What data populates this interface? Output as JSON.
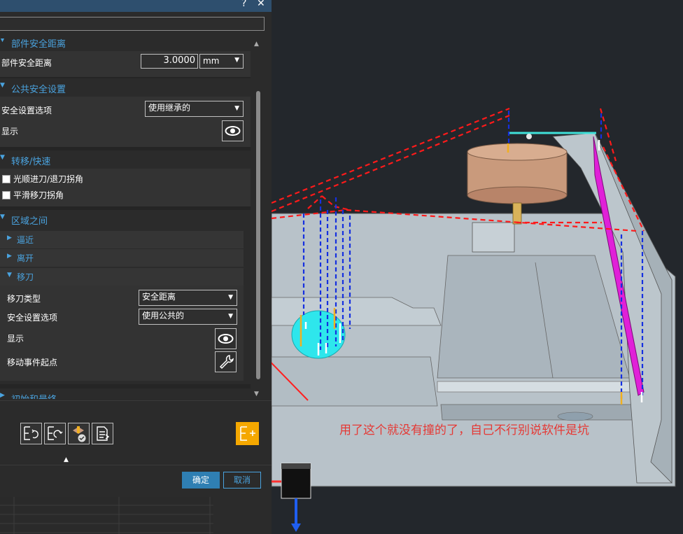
{
  "titlebar": {
    "help_icon": "?",
    "close_icon": "✕"
  },
  "part_clearance": {
    "header": "部件安全距离",
    "label": "部件安全距离",
    "value": "3.0000",
    "unit": "mm"
  },
  "common_clearance": {
    "header": "公共安全设置",
    "option_label": "安全设置选项",
    "option_value": "使用继承的",
    "display_label": "显示"
  },
  "transfer_rapid": {
    "header": "转移/快速",
    "smooth_label": "光顺进刀/退刀拐角",
    "smooth_checked": false,
    "smooth_transfer_label": "平滑移刀拐角",
    "smooth_transfer_checked": false
  },
  "between_regions": {
    "header": "区域之间",
    "approach": "逼近",
    "depart": "离开",
    "transfer": {
      "header": "移刀",
      "type_label": "移刀类型",
      "type_value": "安全距离",
      "option_label": "安全设置选项",
      "option_value": "使用公共的",
      "display_label": "显示",
      "start_label": "移动事件起点"
    }
  },
  "initial_final": {
    "header": "初始和最终"
  },
  "footer": {
    "ok": "确定",
    "cancel": "取消"
  },
  "annotation": "用了这个就没有撞的了，自己不行别说软件是坑",
  "colors": {
    "accent": "#4aa3df",
    "annotation": "#e53935",
    "ok_button": "#2f7fb3"
  }
}
